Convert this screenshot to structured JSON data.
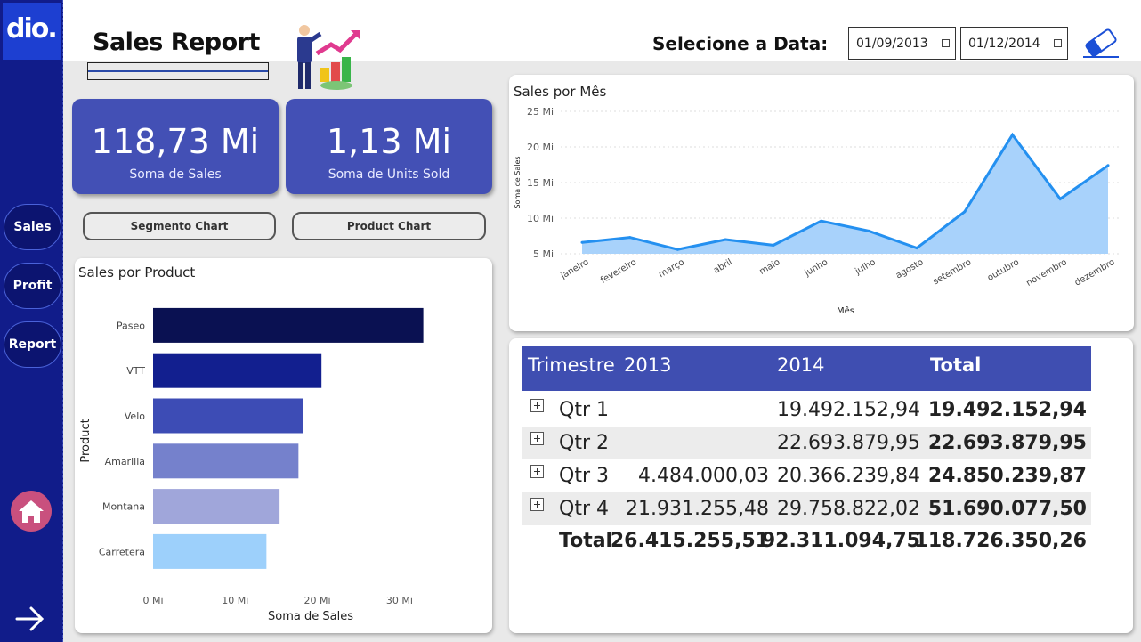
{
  "logo": {
    "text": "dio."
  },
  "sidebar": {
    "items": [
      {
        "label": "Sales"
      },
      {
        "label": "Profit"
      },
      {
        "label": "Report"
      }
    ]
  },
  "header": {
    "title": "Sales Report",
    "date_label": "Selecione a Data:",
    "date_start": "01/09/2013",
    "date_end": "01/12/2014"
  },
  "kpis": [
    {
      "value": "118,73 Mi",
      "label": "Soma de Sales"
    },
    {
      "value": "1,13 Mi",
      "label": "Soma de Units Sold"
    }
  ],
  "buttons": {
    "segmento": "Segmento Chart",
    "product": "Product Chart"
  },
  "colors": {
    "sidebar": "#111c8a",
    "accent": "#3f4eb1",
    "area": "#a8d2fb",
    "line": "#2490f0"
  },
  "chart_data": [
    {
      "type": "bar",
      "orientation": "horizontal",
      "title": "Sales por Product",
      "xlabel": "Soma de Sales",
      "ylabel": "Product",
      "categories": [
        "Paseo",
        "VTT",
        "Velo",
        "Amarilla",
        "Montana",
        "Carretera"
      ],
      "values": [
        32.9,
        20.5,
        18.3,
        17.7,
        15.4,
        13.8
      ],
      "colors": [
        "#0a1152",
        "#121f8f",
        "#3d4cb5",
        "#7581cc",
        "#a0a6da",
        "#9dd0fb"
      ],
      "xlim": [
        0,
        35
      ],
      "ticks": [
        "0 Mi",
        "10 Mi",
        "20 Mi",
        "30 Mi"
      ],
      "tick_values": [
        0,
        10,
        20,
        30
      ]
    },
    {
      "type": "area",
      "title": "Sales por Mês",
      "xlabel": "Mês",
      "ylabel": "Soma de Sales",
      "categories": [
        "janeiro",
        "fevereiro",
        "março",
        "abril",
        "maio",
        "junho",
        "julho",
        "agosto",
        "setembro",
        "outubro",
        "novembro",
        "dezembro"
      ],
      "values": [
        6.6,
        7.3,
        5.6,
        7.0,
        6.2,
        9.6,
        8.2,
        5.8,
        10.9,
        21.7,
        12.7,
        17.4
      ],
      "ylim": [
        5,
        25
      ],
      "ticks": [
        "5 Mi",
        "10 Mi",
        "15 Mi",
        "20 Mi",
        "25 Mi"
      ],
      "tick_values": [
        5,
        10,
        15,
        20,
        25
      ]
    }
  ],
  "matrix": {
    "headers": [
      "Trimestre",
      "2013",
      "2014",
      "Total"
    ],
    "rows": [
      {
        "label": "Qtr 1",
        "y2013": "",
        "y2014": "19.492.152,94",
        "total": "19.492.152,94"
      },
      {
        "label": "Qtr 2",
        "y2013": "",
        "y2014": "22.693.879,95",
        "total": "22.693.879,95"
      },
      {
        "label": "Qtr 3",
        "y2013": "4.484.000,03",
        "y2014": "20.366.239,84",
        "total": "24.850.239,87"
      },
      {
        "label": "Qtr 4",
        "y2013": "21.931.255,48",
        "y2014": "29.758.822,02",
        "total": "51.690.077,50"
      }
    ],
    "total_row": {
      "label": "Total",
      "y2013": "26.415.255,51",
      "y2014": "92.311.094,75",
      "total": "118.726.350,26"
    }
  }
}
